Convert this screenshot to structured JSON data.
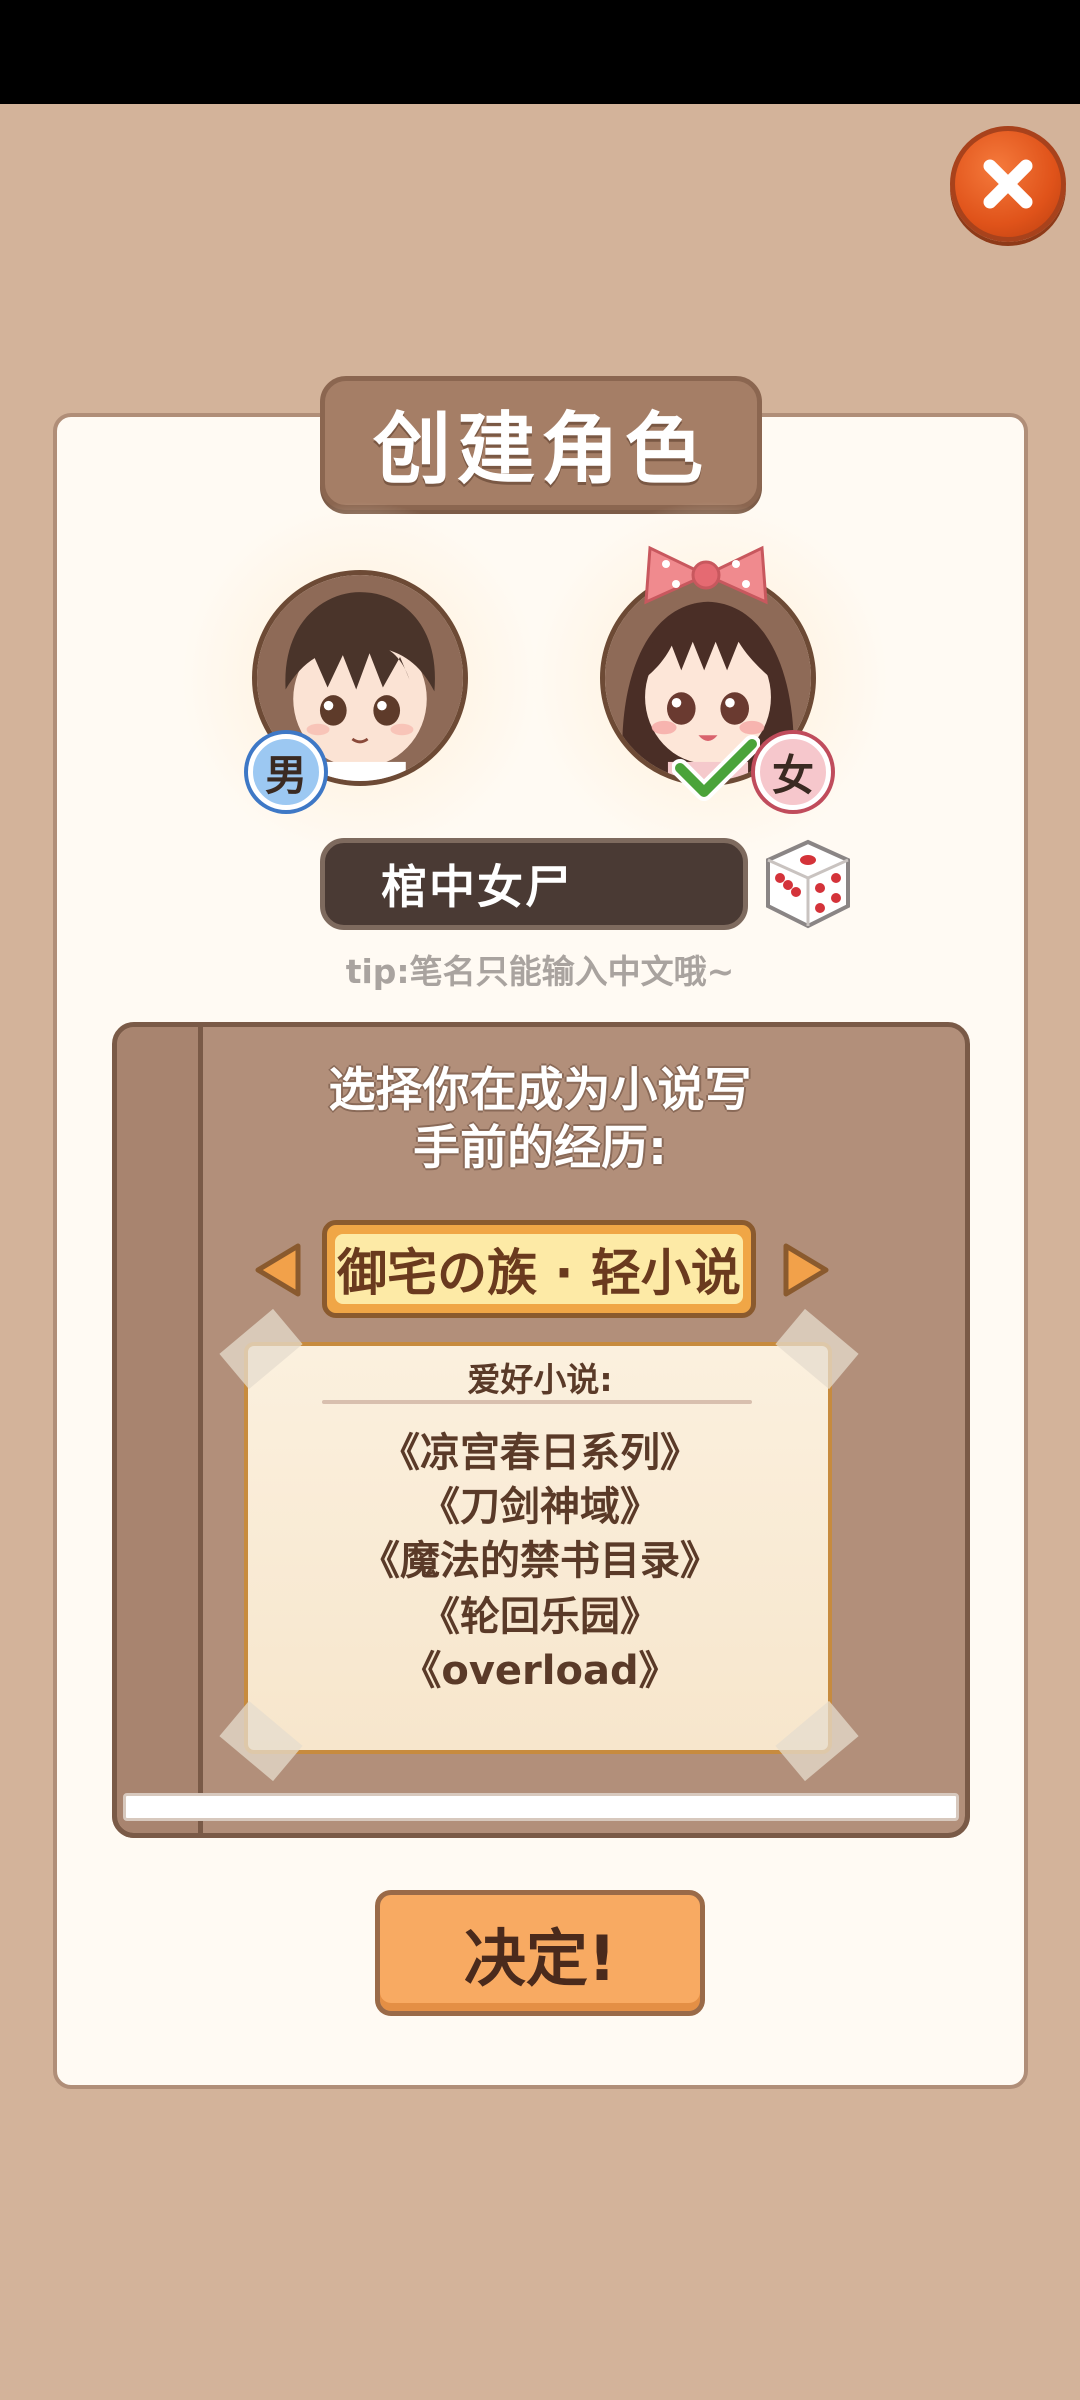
{
  "header": {
    "title": "创建角色"
  },
  "gender": {
    "male_label": "男",
    "female_label": "女",
    "selected": "female"
  },
  "name_input": {
    "value": "棺中女尸"
  },
  "tip": "tip:笔名只能输入中文哦~",
  "experience": {
    "heading_line1": "选择你在成为小说写",
    "heading_line2": "手前的经历:",
    "selected_option": "御宅の族 · 轻小说"
  },
  "hobby": {
    "title": "爱好小说:",
    "novels": [
      "《凉宫春日系列》",
      "《刀剑神域》",
      "《魔法的禁书目录》",
      "《轮回乐园》",
      "《overload》"
    ]
  },
  "confirm_label": "决定!",
  "icons": {
    "close": "close-icon",
    "dice": "dice-icon",
    "check": "check-icon",
    "arrow_left": "arrow-left-icon",
    "arrow_right": "arrow-right-icon"
  },
  "colors": {
    "background": "#d3b39a",
    "panel": "#fffaf3",
    "accent": "#f0a646",
    "close": "#e0531a"
  }
}
